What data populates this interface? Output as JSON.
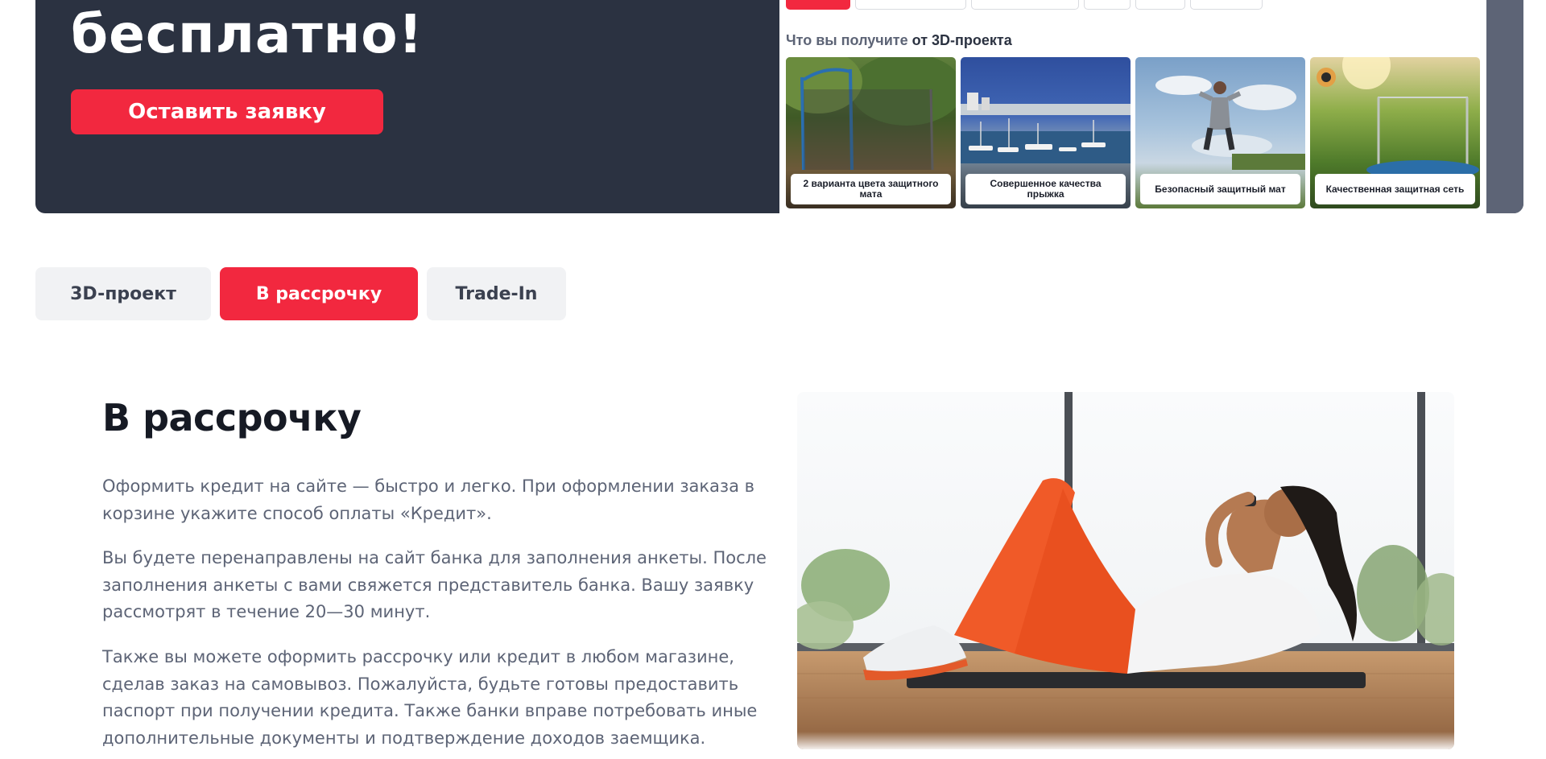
{
  "banner": {
    "title": "бесплатно!",
    "cta_label": "Оставить заявку",
    "promo": {
      "heading_prefix": "Что вы получите",
      "heading_suffix": "от 3D-проекта",
      "cards": [
        {
          "caption": "2 варианта цвета защитного мата"
        },
        {
          "caption": "Совершенное качества прыжка"
        },
        {
          "caption": "Безопасный защитный мат"
        },
        {
          "caption": "Качественная защитная сеть"
        }
      ]
    }
  },
  "tabs": [
    {
      "label": "3D-проект",
      "active": false
    },
    {
      "label": "В рассрочку",
      "active": true
    },
    {
      "label": "Trade-In",
      "active": false
    }
  ],
  "content": {
    "title": "В рассрочку",
    "paragraphs": [
      "Оформить кредит на сайте — быстро и легко. При оформлении заказа в корзине укажите способ оплаты «Кредит».",
      "Вы будете перенаправлены на сайт банка для заполнения анкеты. После заполнения анкеты с вами свяжется представитель банка. Вашу заявку рассмотрят в течение 20—30 минут.",
      "Также вы можете оформить рассрочку или кредит в любом магазине, сделав заказ на самовывоз. Пожалуйста, будьте готовы предоставить паспорт при получении кредита. Также банки вправе потребовать иные дополнительные документы и подтверждение доходов заемщика."
    ]
  },
  "colors": {
    "accent": "#f2283f",
    "banner_bg": "#2b3241",
    "tab_bg": "#f1f2f4",
    "text_muted": "#5d6476"
  }
}
